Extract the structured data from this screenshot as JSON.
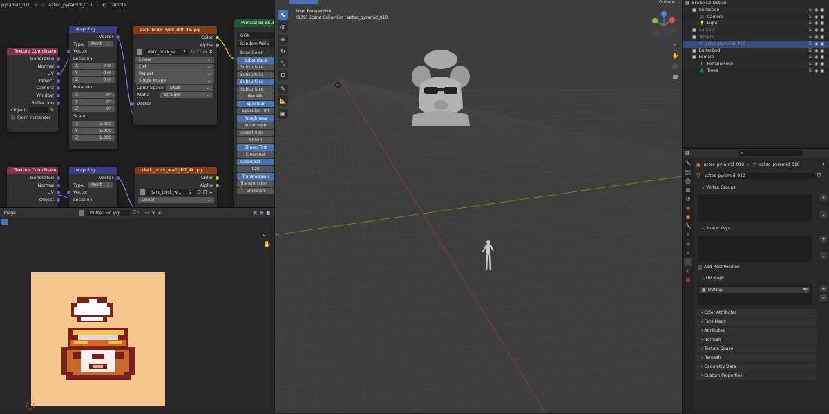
{
  "node_editor": {
    "breadcrumb": [
      "pyramid_010",
      "aztec_pyramid_010",
      "temple"
    ],
    "texcoord": {
      "title": "Texture Coordinate",
      "outputs": [
        "Generated",
        "Normal",
        "UV",
        "Object",
        "Camera",
        "Window",
        "Reflection"
      ],
      "object_label": "Object:",
      "from_instancer": "From Instancer"
    },
    "mapping": {
      "title": "Mapping",
      "out": "Vector",
      "type_label": "Type:",
      "type_value": "Point",
      "in": "Vector",
      "location": "Location:",
      "loc": [
        "0 m",
        "0 m",
        "0 m"
      ],
      "rotation": "Rotation:",
      "rot": [
        "0°",
        "0°",
        "0°"
      ],
      "scale": "Scale:",
      "scl": [
        "1.000",
        "1.000",
        "1.000"
      ],
      "axes": [
        "X",
        "Y",
        "Z"
      ]
    },
    "image_tex": {
      "title": "dark_brick_wall_diff_4k.jpg",
      "out_color": "Color",
      "out_alpha": "Alpha",
      "image_name": "dark_brick_w...",
      "users": "2",
      "interp": "Linear",
      "proj": "Flat",
      "ext": "Repeat",
      "source": "Single Image",
      "cs_label": "Color Space",
      "cs_value": "sRGB",
      "alpha_label": "Alpha",
      "alpha_value": "Straight",
      "in_vector": "Vector"
    },
    "bsdf": {
      "title": "Principled BSDF",
      "distribution": "GGX",
      "sss_method": "Random Walk",
      "rows": [
        "Base Color",
        "Subsurface",
        "Subsurface Radius",
        "Subsurface Co...",
        "Subsurface IOR",
        "Subsurface Aniso",
        "Metallic",
        "Specular",
        "Specular Tint",
        "Roughness",
        "Anisotropic",
        "Anisotropic Rotat",
        "Sheen",
        "Sheen Tint",
        "Clearcoat",
        "Clearcoat Rough",
        "IOR",
        "Transmission",
        "Transmission Ro",
        "Emission"
      ]
    },
    "texcoord2": {
      "title": "Texture Coordinate",
      "outputs": [
        "Generated",
        "Normal",
        "UV",
        "Object"
      ]
    },
    "mapping2": {
      "title": "Mapping",
      "out": "Vector",
      "type_label": "Type:",
      "type_value": "Point",
      "in": "Vector",
      "location": "Location:"
    },
    "image_tex2": {
      "title": "dark_brick_wall_diff_4k.jpg",
      "out_color": "Color",
      "out_alpha": "Alpha",
      "image_name": "dark_brick_w...",
      "users": "2",
      "interp": "Linear"
    }
  },
  "image_editor": {
    "mode": "Image",
    "image_name": "butterGod.jpg"
  },
  "viewport": {
    "view_name": "User Perspective",
    "collection_info": "(179) Scene Collection | aztec_pyramid_010",
    "options_label": "Options"
  },
  "outliner": {
    "rows": [
      {
        "label": "Scene Collection",
        "indent": 0
      },
      {
        "label": "Collection",
        "indent": 1
      },
      {
        "label": "Camera",
        "indent": 2
      },
      {
        "label": "Light",
        "indent": 2
      },
      {
        "label": "Carpets",
        "indent": 1
      },
      {
        "label": "Temple",
        "indent": 1
      },
      {
        "label": "aztec_pyramid_010",
        "indent": 2
      },
      {
        "label": "ButterGod",
        "indent": 1
      },
      {
        "label": "Female",
        "indent": 1
      },
      {
        "label": "FemaleModel",
        "indent": 2
      },
      {
        "label": "Trees",
        "indent": 2
      }
    ]
  },
  "properties": {
    "object_name": "aztec_pyramid_010",
    "mesh_name": "aztec_pyramid_010",
    "mesh_field": "aztec_pyramid_010",
    "vertex_groups": "Vertex Groups",
    "shape_keys": "Shape Keys",
    "add_rest_position": "Add Rest Position",
    "uv_maps": "UV Maps",
    "uv_map_item": "UVMap",
    "collapsed": [
      "Color Attributes",
      "Face Maps",
      "Attributes",
      "Normals",
      "Texture Space",
      "Remesh",
      "Geometry Data",
      "Custom Properties"
    ]
  },
  "colors": {
    "texcoord_header": "#83314a",
    "mapping_header": "#3c3c83",
    "image_header": "#863b11",
    "bsdf_header": "#1b5732",
    "selection": "#4772b3"
  }
}
